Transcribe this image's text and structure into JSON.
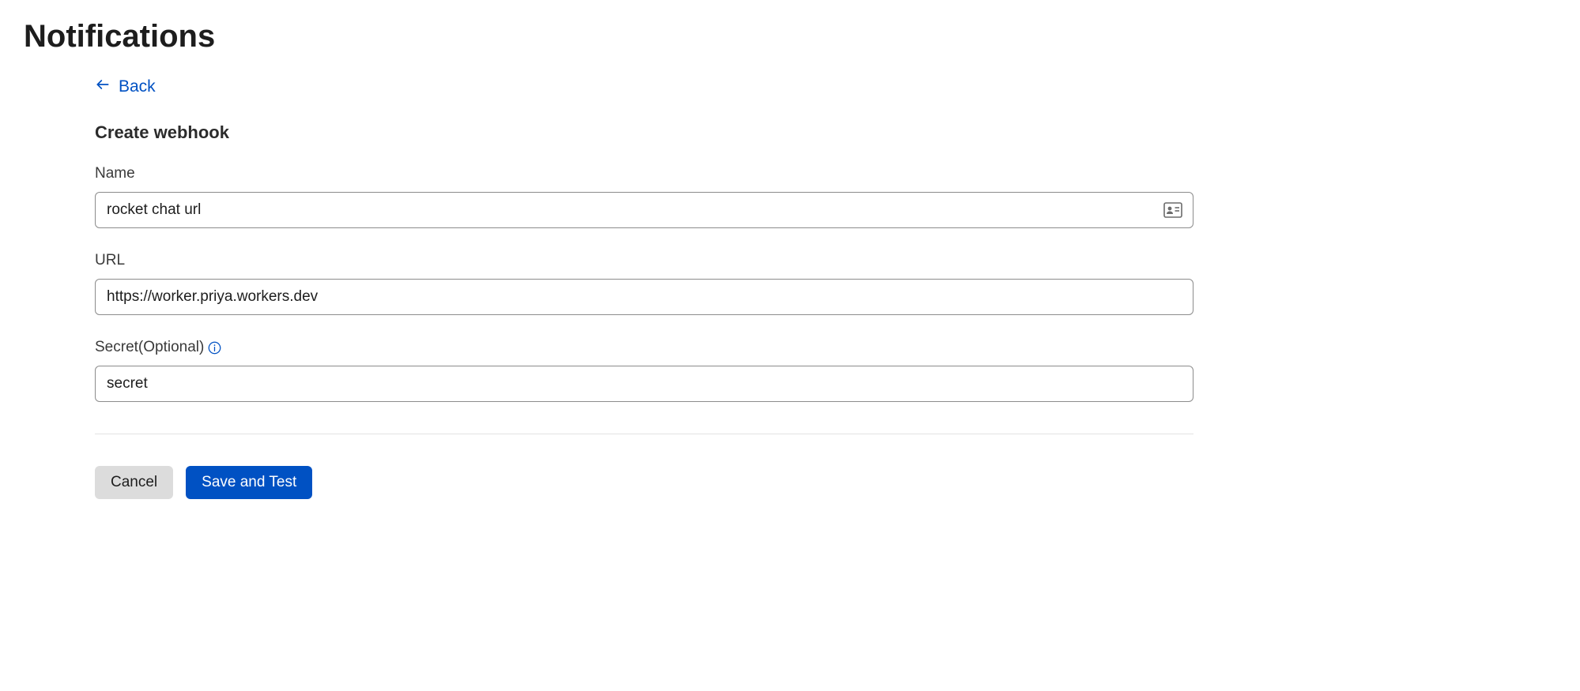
{
  "page": {
    "title": "Notifications"
  },
  "nav": {
    "back_label": "Back"
  },
  "form": {
    "heading": "Create webhook",
    "name": {
      "label": "Name",
      "value": "rocket chat url"
    },
    "url": {
      "label": "URL",
      "value": "https://worker.priya.workers.dev"
    },
    "secret": {
      "label": "Secret(Optional)",
      "value": "secret"
    }
  },
  "buttons": {
    "cancel": "Cancel",
    "save": "Save and Test"
  }
}
